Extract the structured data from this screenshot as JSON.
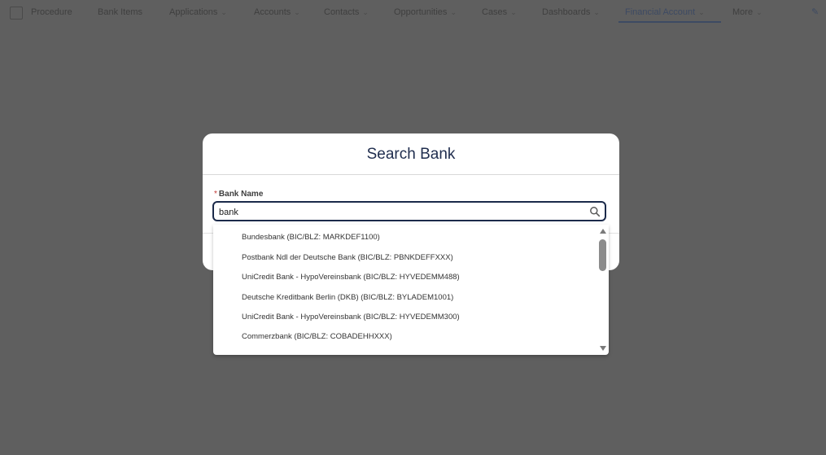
{
  "nav": {
    "items": [
      {
        "label": "Procedure",
        "dropdown": false
      },
      {
        "label": "Bank Items",
        "dropdown": false
      },
      {
        "label": "Applications",
        "dropdown": true
      },
      {
        "label": "Accounts",
        "dropdown": true
      },
      {
        "label": "Contacts",
        "dropdown": true
      },
      {
        "label": "Opportunities",
        "dropdown": true
      },
      {
        "label": "Cases",
        "dropdown": true
      },
      {
        "label": "Dashboards",
        "dropdown": true
      },
      {
        "label": "Financial Account",
        "dropdown": true,
        "active": true
      },
      {
        "label": "More",
        "dropdown": true
      }
    ]
  },
  "modal": {
    "title": "Search Bank",
    "field": {
      "required_mark": "*",
      "label": "Bank Name",
      "value": "bank"
    },
    "icons": {
      "search": "search-icon"
    }
  },
  "dropdown": {
    "options": [
      "Bundesbank (BIC/BLZ: MARKDEF1100)",
      "Postbank Ndl der Deutsche Bank (BIC/BLZ: PBNKDEFFXXX)",
      "UniCredit Bank - HypoVereinsbank (BIC/BLZ: HYVEDEMM488)",
      "Deutsche Kreditbank Berlin (DKB) (BIC/BLZ: BYLADEM1001)",
      "UniCredit Bank - HypoVereinsbank (BIC/BLZ: HYVEDEMM300)",
      "Commerzbank (BIC/BLZ: COBADEHHXXX)"
    ]
  },
  "colors": {
    "overlay": "#5f5f5f",
    "title": "#1f2d4e",
    "focus_border": "#1b2a4a",
    "required": "#c23934"
  }
}
